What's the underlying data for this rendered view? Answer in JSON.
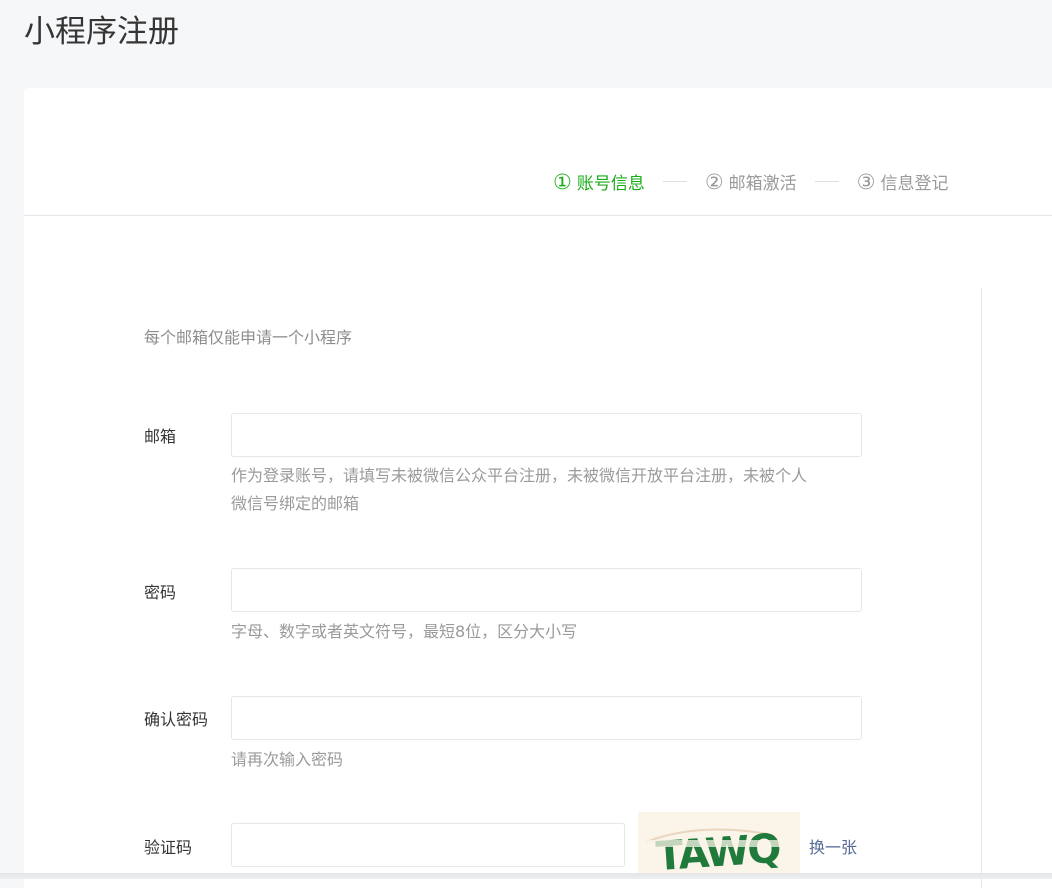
{
  "page": {
    "title": "小程序注册"
  },
  "steps": [
    {
      "num": "①",
      "label": "账号信息",
      "active": true
    },
    {
      "num": "②",
      "label": "邮箱激活",
      "active": false
    },
    {
      "num": "③",
      "label": "信息登记",
      "active": false
    }
  ],
  "form": {
    "tip": "每个邮箱仅能申请一个小程序",
    "email": {
      "label": "邮箱",
      "value": "",
      "hint_line1": "作为登录账号，请填写未被微信公众平台注册，未被微信开放平台注册，未被个人",
      "hint_line2": "微信号绑定的邮箱"
    },
    "password": {
      "label": "密码",
      "value": "",
      "hint": "字母、数字或者英文符号，最短8位，区分大小写"
    },
    "confirm_password": {
      "label": "确认密码",
      "value": "",
      "hint": "请再次输入密码"
    },
    "captcha": {
      "label": "验证码",
      "value": "",
      "image_text": "TAWQ",
      "refresh_label": "换一张"
    }
  },
  "colors": {
    "accent": "#1aad19",
    "link": "#576b95",
    "captcha_text": "#1f7a3c",
    "page_bg": "#f6f7f9"
  }
}
